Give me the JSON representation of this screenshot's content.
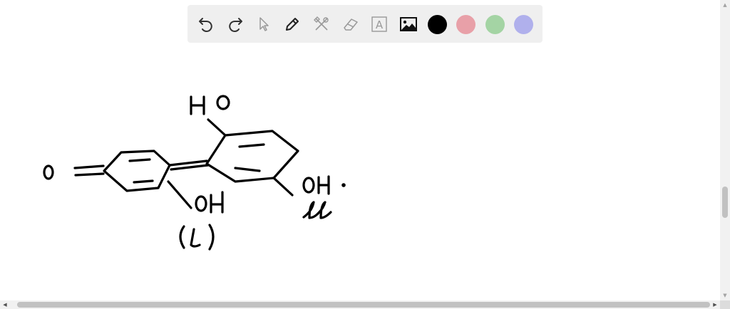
{
  "toolbar": {
    "tools": [
      {
        "name": "undo",
        "icon": "undo-icon"
      },
      {
        "name": "redo",
        "icon": "redo-icon"
      },
      {
        "name": "select",
        "icon": "pointer-icon"
      },
      {
        "name": "pen",
        "icon": "pencil-icon"
      },
      {
        "name": "tools",
        "icon": "hammer-wrench-icon"
      },
      {
        "name": "eraser",
        "icon": "eraser-icon"
      },
      {
        "name": "text",
        "icon": "text-box-icon",
        "glyph": "A"
      },
      {
        "name": "image",
        "icon": "image-icon"
      }
    ],
    "colors": [
      {
        "name": "black",
        "hex": "#000000"
      },
      {
        "name": "red",
        "hex": "#e8a0a8"
      },
      {
        "name": "green",
        "hex": "#a4d4a4"
      },
      {
        "name": "blue",
        "hex": "#b0b0ec"
      }
    ],
    "background": "#efefef"
  },
  "scrollbars": {
    "vertical_arrows": [
      "▲",
      "▼"
    ],
    "horizontal_arrows": [
      "◀",
      "▶"
    ]
  }
}
